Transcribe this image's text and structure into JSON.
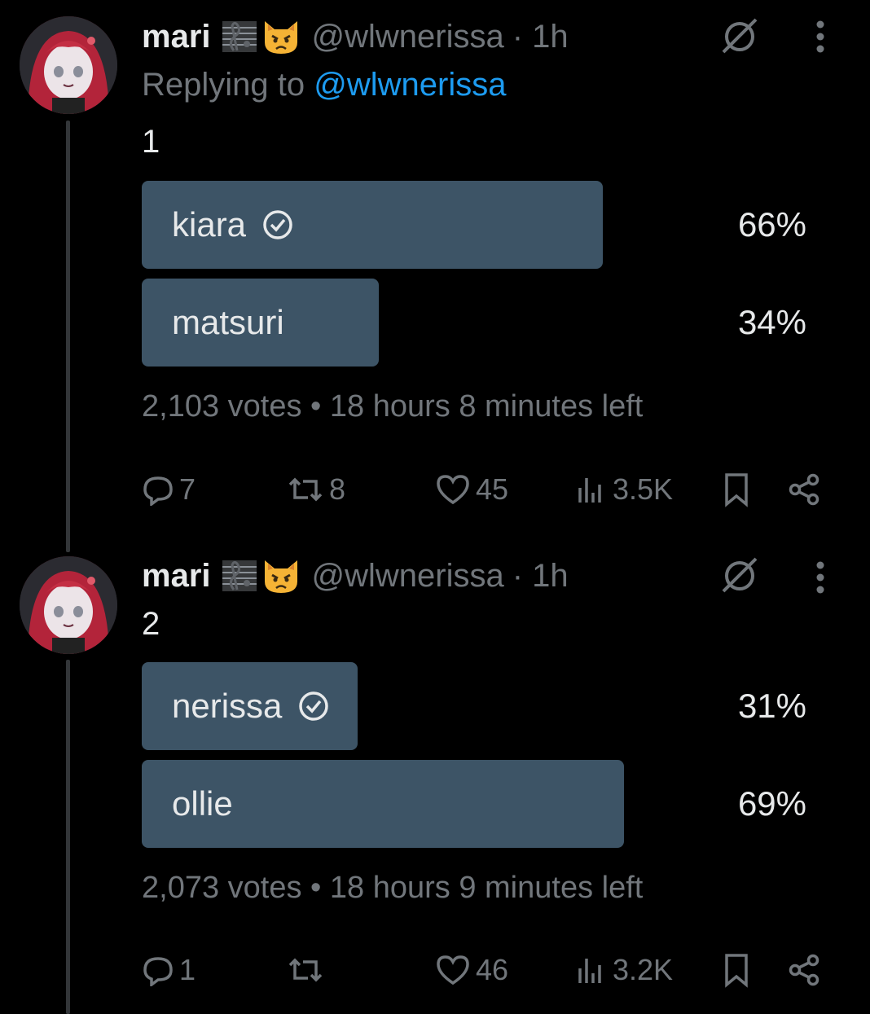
{
  "colors": {
    "background": "#000000",
    "text": "#e7e9ea",
    "muted": "#71767b",
    "link": "#1d9bf0",
    "poll_bar": "#3d5466"
  },
  "tweets": [
    {
      "name": "mari",
      "emojis": [
        "musical-score-icon",
        "pouting-cat-icon"
      ],
      "handle": "@wlwnerissa",
      "time": "· 1h",
      "replying_prefix": "Replying to ",
      "replying_handle": "@wlwnerissa",
      "text": "1",
      "poll": {
        "options": [
          {
            "label": "kiara",
            "percent": "66%",
            "fill": 0.66,
            "selected": true
          },
          {
            "label": "matsuri",
            "percent": "34%",
            "fill": 0.34,
            "selected": false
          }
        ],
        "meta": "2,103 votes • 18 hours 8 minutes left"
      },
      "actions": {
        "replies": "7",
        "reposts": "8",
        "likes": "45",
        "views": "3.5K"
      }
    },
    {
      "name": "mari",
      "emojis": [
        "musical-score-icon",
        "pouting-cat-icon"
      ],
      "handle": "@wlwnerissa",
      "time": "· 1h",
      "text": "2",
      "poll": {
        "options": [
          {
            "label": "nerissa",
            "percent": "31%",
            "fill": 0.31,
            "selected": true
          },
          {
            "label": "ollie",
            "percent": "69%",
            "fill": 0.69,
            "selected": false
          }
        ],
        "meta": "2,073 votes • 18 hours 9 minutes left"
      },
      "actions": {
        "replies": "1",
        "reposts": "",
        "likes": "46",
        "views": "3.2K"
      }
    }
  ]
}
